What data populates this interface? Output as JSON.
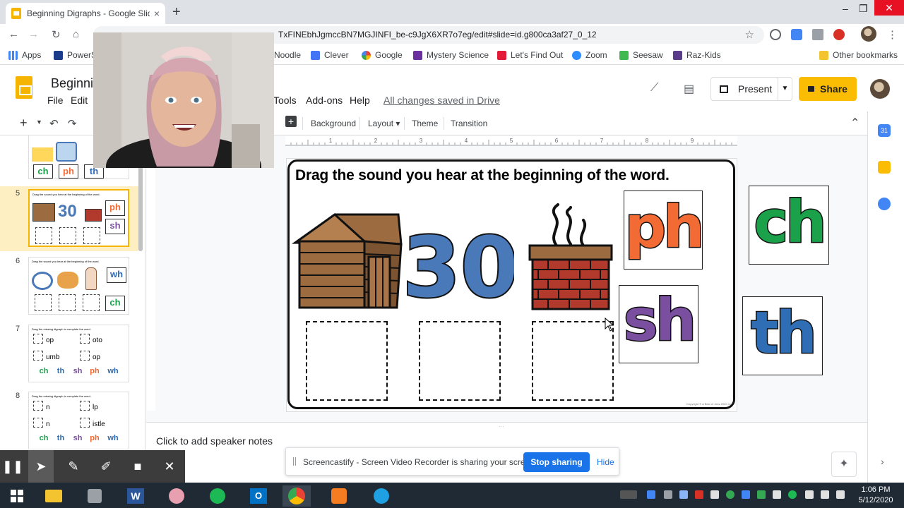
{
  "browser": {
    "tab_title": "Beginning Digraphs - Google Slides",
    "tab_close": "×",
    "new_tab": "+",
    "url": "TxFINEbhJgmccBN7MGJINFI_be-c9JgX6XR7o7eg/edit#slide=id.g800ca3af27_0_12",
    "bookmarks": [
      "Apps",
      "PowerS",
      "Noodle",
      "Clever",
      "Google",
      "Mystery Science",
      "Let's Find Out",
      "Zoom",
      "Seesaw",
      "Raz-Kids",
      "Other bookmarks"
    ]
  },
  "slides_app": {
    "doc_title": "Beginning",
    "menus": [
      "File",
      "Edit",
      "Tools",
      "Add-ons",
      "Help"
    ],
    "save_status": "All changes saved in Drive",
    "present_label": "Present",
    "share_label": "Share",
    "toolbar": [
      "Background",
      "Layout",
      "Theme",
      "Transition"
    ]
  },
  "filmstrip": {
    "slides": [
      {
        "num": "5",
        "title": "Drag the sound you hear at the beginning of the word.",
        "tiles": [
          "ph",
          "sh"
        ]
      },
      {
        "num": "6",
        "title": "Drag the sound you hear at the beginning of the word.",
        "tiles": [
          "wh",
          "ch"
        ]
      },
      {
        "num": "7",
        "title": "Drag the missing digraph to complete the word.",
        "words": [
          "op",
          "oto",
          "umb",
          "op"
        ],
        "tiles": [
          "ch",
          "th",
          "sh",
          "ph",
          "wh"
        ]
      },
      {
        "num": "8",
        "title": "Drag the missing digraph to complete the word.",
        "words": [
          "n",
          "lp",
          "n",
          "istle"
        ],
        "tiles": [
          "ch",
          "th",
          "sh",
          "ph",
          "wh"
        ]
      }
    ],
    "top_partial_tiles": [
      "ch",
      "ph",
      "th"
    ]
  },
  "slide": {
    "instruction": "Drag the sound you hear at the beginning of the word.",
    "number_image": "30",
    "tiles": [
      {
        "text": "ph",
        "color": "#f26b35"
      },
      {
        "text": "sh",
        "color": "#7a4fa0"
      },
      {
        "text": "ch",
        "color": "#1aa14a"
      },
      {
        "text": "th",
        "color": "#2f6db5"
      }
    ],
    "copyright": "Copyright © A Best of Jess 2020 Inc"
  },
  "colors": {
    "accent_yellow": "#fbbc04",
    "cabin_brown": "#9c6b3f",
    "number_blue": "#4a79b9",
    "brick_red": "#b23a2c"
  },
  "notes_placeholder": "Click to add speaker notes",
  "screencastify": {
    "message": "Screencastify - Screen Video Recorder is sharing your screen.",
    "stop_label": "Stop sharing",
    "hide_label": "Hide"
  },
  "taskbar": {
    "time": "1:06 PM",
    "date": "5/12/2020"
  }
}
